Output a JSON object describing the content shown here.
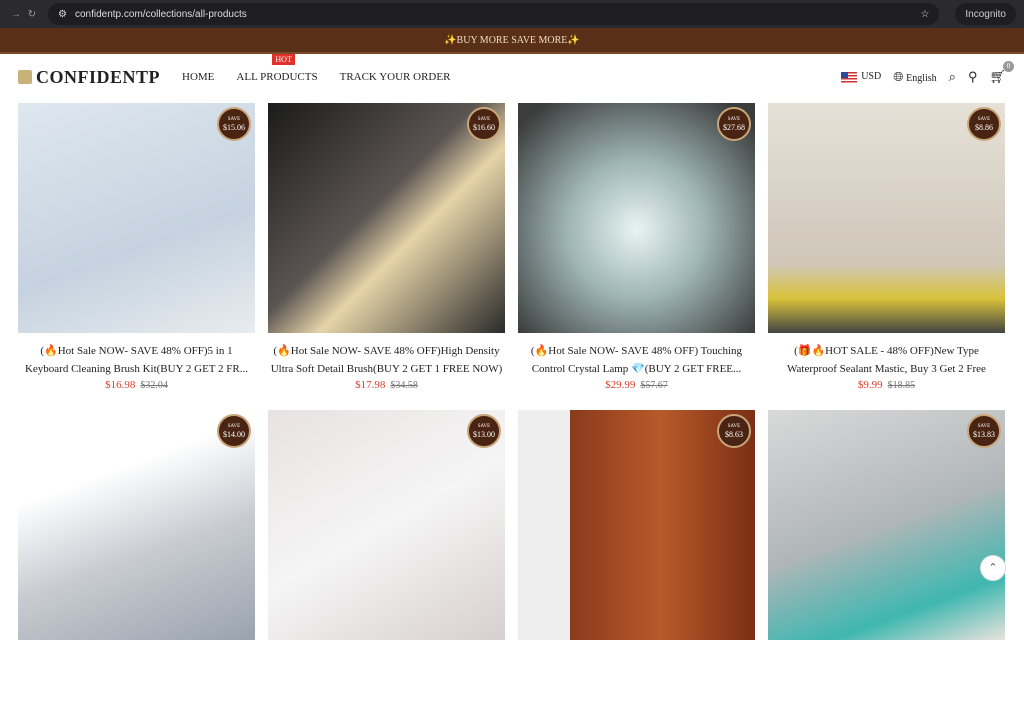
{
  "browser": {
    "url": "confidentp.com/collections/all-products",
    "mode": "Incognito"
  },
  "announcement": "✨BUY MORE SAVE MORE✨",
  "header": {
    "logo": "CONFIDENTP",
    "menu": [
      "HOME",
      "ALL PRODUCTS",
      "TRACK YOUR ORDER"
    ],
    "hot_badge": "HOT",
    "currency": "USD",
    "language": "English",
    "cart_count": "0"
  },
  "save_label": "SAVE",
  "products": [
    {
      "title": "(🔥Hot Sale NOW- SAVE 48% OFF)5 in 1 Keyboard Cleaning Brush Kit(BUY 2 GET 2 FR...",
      "price": "$16.98",
      "compare": "$32.04",
      "save": "$15.06",
      "bg": "linear-gradient(160deg,#dfe7ef,#c5d2df 60%,#e8ecef)"
    },
    {
      "title": "(🔥Hot Sale NOW- SAVE 48% OFF)High Density Ultra Soft Detail Brush(BUY 2 GET 1 FREE NOW)",
      "price": "$17.98",
      "compare": "$34.58",
      "save": "$16.60",
      "bg": "linear-gradient(135deg,#1b1b1b,#5b5552 45%,#e6d3a8 60%,#2a2a2a)"
    },
    {
      "title": "(🔥Hot Sale NOW- SAVE 48% OFF) Touching Control Crystal Lamp 💎(BUY 2 GET FREE...",
      "price": "$29.99",
      "compare": "$57.67",
      "save": "$27.68",
      "bg": "radial-gradient(circle at 50% 55%,#e8f4f2,#9fb4b5 40%,#3b3d3c 90%)"
    },
    {
      "title": "(🎁🔥HOT SALE - 48% OFF)New Type Waterproof Sealant Mastic, Buy 3 Get 2 Free",
      "price": "$9.99",
      "compare": "$18.85",
      "save": "$8.86",
      "bg": "linear-gradient(180deg,#e6e1d8,#cfc6b8 70%,#d9c33a 85%,#444 100%)"
    },
    {
      "title": "",
      "price": "",
      "compare": "",
      "save": "$14.00",
      "bg": "linear-gradient(160deg,#fff 30%,#c8ccd2 60%,#9aa3ad)"
    },
    {
      "title": "",
      "price": "",
      "compare": "",
      "save": "$13.00",
      "bg": "linear-gradient(150deg,#e8e2e2,#f5f5f5 50%,#d7cfcf)"
    },
    {
      "title": "",
      "price": "",
      "compare": "",
      "save": "$8.63",
      "bg": "linear-gradient(90deg,#eee 0 22%,#8a3a1c 22%,#b85a2a 60%,#7a2f15)"
    },
    {
      "title": "",
      "price": "",
      "compare": "",
      "save": "$13.83",
      "bg": "linear-gradient(160deg,#d9d9d9,#b0b6b8 50%,#3fb7b0 80%,#e9e3dc)"
    }
  ]
}
